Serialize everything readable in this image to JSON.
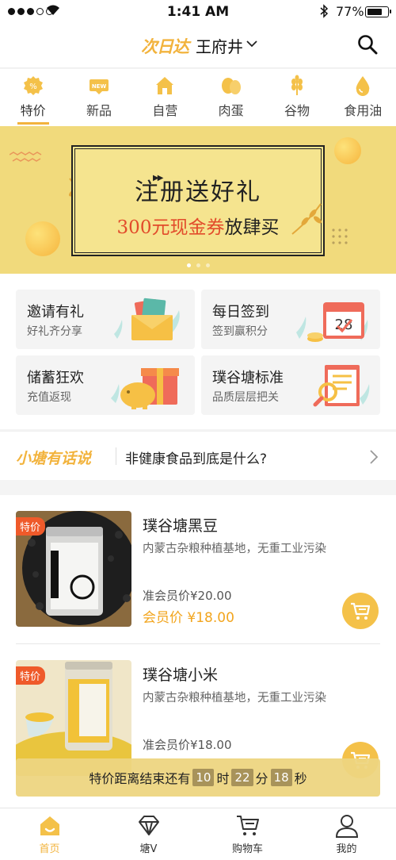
{
  "status_bar": {
    "time": "1:41 AM",
    "battery": "77%",
    "battery_level": 0.77
  },
  "header": {
    "logo": "次日达",
    "city": "王府井"
  },
  "categories": [
    {
      "label": "特价",
      "icon": "discount-icon"
    },
    {
      "label": "新品",
      "icon": "new-badge-icon"
    },
    {
      "label": "自营",
      "icon": "store-icon"
    },
    {
      "label": "肉蛋",
      "icon": "meat-egg-icon"
    },
    {
      "label": "谷物",
      "icon": "grain-icon"
    },
    {
      "label": "食用油",
      "icon": "oil-drop-icon"
    }
  ],
  "banner": {
    "title": "注册送好礼",
    "subtitle_highlight": "300元现金券",
    "subtitle_rest": "放肆买",
    "active_slide": 1,
    "slide_count": 3
  },
  "features": [
    {
      "title": "邀请有礼",
      "subtitle": "好礼齐分享",
      "icon": "envelope-icon"
    },
    {
      "title": "每日签到",
      "subtitle": "签到赢积分",
      "icon": "calendar-icon",
      "date": "28"
    },
    {
      "title": "储蓄狂欢",
      "subtitle": "充值返现",
      "icon": "piggy-bank-icon"
    },
    {
      "title": "璞谷塘标准",
      "subtitle": "品质层层把关",
      "icon": "magnifier-doc-icon"
    }
  ],
  "talk": {
    "brand": "小塘有话说",
    "message": "非健康食品到底是什么?"
  },
  "products": [
    {
      "tag": "特价",
      "name": "璞谷塘黑豆",
      "desc": "内蒙古杂粮种植基地，无重工业污染",
      "pre_price": "准会员价¥20.00",
      "member_price": "会员价 ¥18.00"
    },
    {
      "tag": "特价",
      "name": "璞谷塘小米",
      "desc": "内蒙古杂粮种植基地，无重工业污染",
      "pre_price": "准会员价¥18.00",
      "member_price": ""
    }
  ],
  "countdown": {
    "prefix": "特价距离结束还有",
    "hours": "10",
    "h_unit": "时",
    "minutes": "22",
    "m_unit": "分",
    "seconds": "18",
    "s_unit": "秒"
  },
  "tabbar": [
    {
      "label": "首页",
      "icon": "home-icon",
      "active": true
    },
    {
      "label": "塘V",
      "icon": "diamond-icon",
      "active": false
    },
    {
      "label": "购物车",
      "icon": "cart-icon",
      "active": false
    },
    {
      "label": "我的",
      "icon": "profile-icon",
      "active": false
    }
  ],
  "colors": {
    "accent": "#f2b33d",
    "banner_bg": "#f1da7c",
    "tag_red": "#ef5a2a",
    "price_orange": "#f2a51e"
  }
}
